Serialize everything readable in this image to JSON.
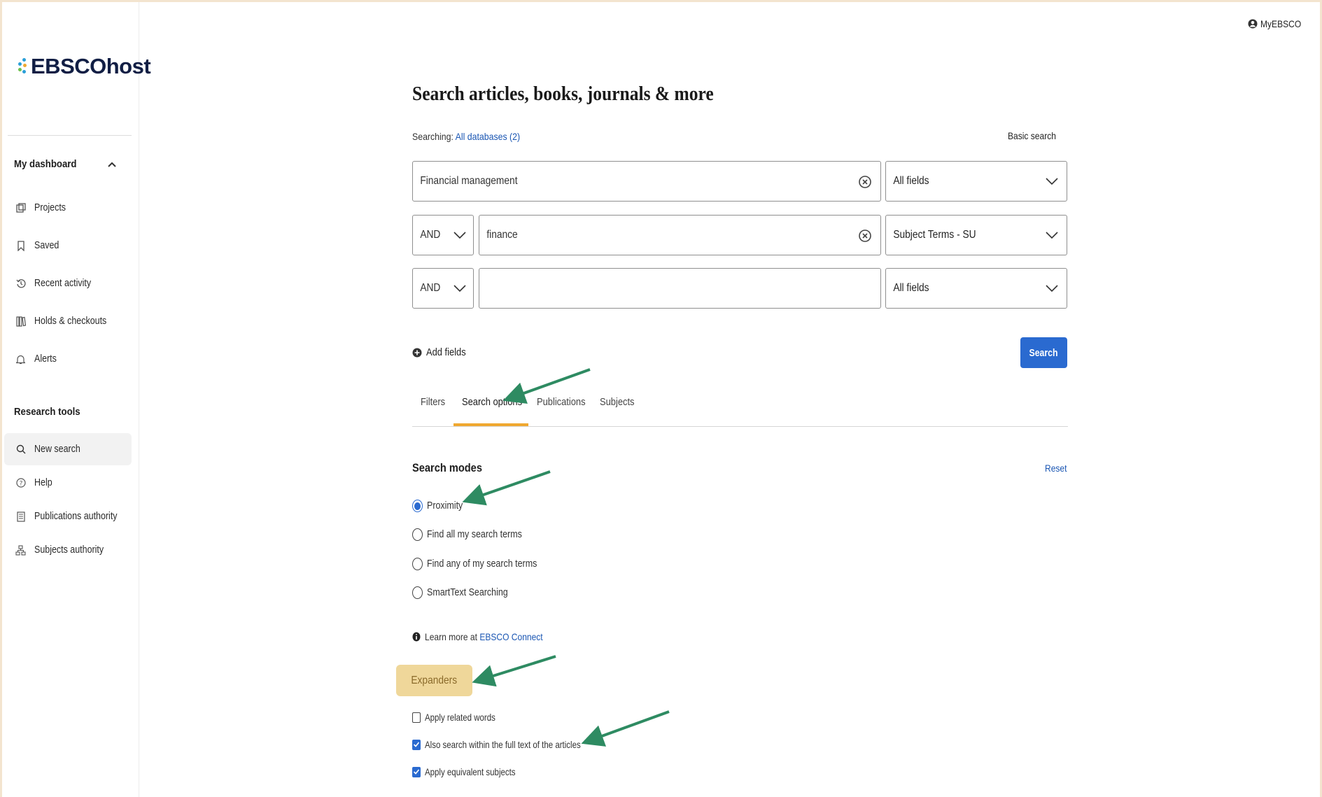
{
  "app": {
    "logo": "EBSCOhost",
    "account_label": "MyEBSCO"
  },
  "sidebar": {
    "dashboard_heading": "My dashboard",
    "dashboard_items": [
      {
        "label": "Projects",
        "icon": "projects-icon"
      },
      {
        "label": "Saved",
        "icon": "bookmark-icon"
      },
      {
        "label": "Recent activity",
        "icon": "history-icon"
      },
      {
        "label": "Holds & checkouts",
        "icon": "books-icon"
      },
      {
        "label": "Alerts",
        "icon": "bell-icon"
      }
    ],
    "tools_heading": "Research tools",
    "tools_items": [
      {
        "label": "New search",
        "icon": "search-icon",
        "active": true
      },
      {
        "label": "Help",
        "icon": "help-icon"
      },
      {
        "label": "Publications authority",
        "icon": "publications-icon"
      },
      {
        "label": "Subjects authority",
        "icon": "hierarchy-icon"
      }
    ]
  },
  "main": {
    "title": "Search articles, books, journals & more",
    "searching_label": "Searching:",
    "searching_link": "All databases (2)",
    "basic_search": "Basic search",
    "rows": [
      {
        "operator": "",
        "value": "Financial management",
        "field": "All fields"
      },
      {
        "operator": "AND",
        "value": "finance",
        "field": "Subject Terms - SU"
      },
      {
        "operator": "AND",
        "value": "",
        "field": "All fields"
      }
    ],
    "add_fields": "Add fields",
    "search_button": "Search",
    "tabs": [
      "Filters",
      "Search options",
      "Publications",
      "Subjects"
    ],
    "active_tab": "Search options",
    "search_modes_title": "Search modes",
    "reset": "Reset",
    "modes": [
      {
        "label": "Proximity",
        "selected": true
      },
      {
        "label": "Find all my search terms",
        "selected": false
      },
      {
        "label": "Find any of my search terms",
        "selected": false
      },
      {
        "label": "SmartText Searching",
        "selected": false
      }
    ],
    "learn_prefix": "Learn more at",
    "learn_link": "EBSCO Connect",
    "expanders_title": "Expanders",
    "expanders": [
      {
        "label": "Apply related words",
        "checked": false
      },
      {
        "label": "Also search within the full text of the articles",
        "checked": true
      },
      {
        "label": "Apply equivalent subjects",
        "checked": true
      }
    ]
  },
  "colors": {
    "accent": "#2a6ad0",
    "link": "#1a56b3",
    "tab_underline": "#f0a830",
    "highlight": "#efd79a",
    "annotation_arrow": "#2e8b62"
  }
}
